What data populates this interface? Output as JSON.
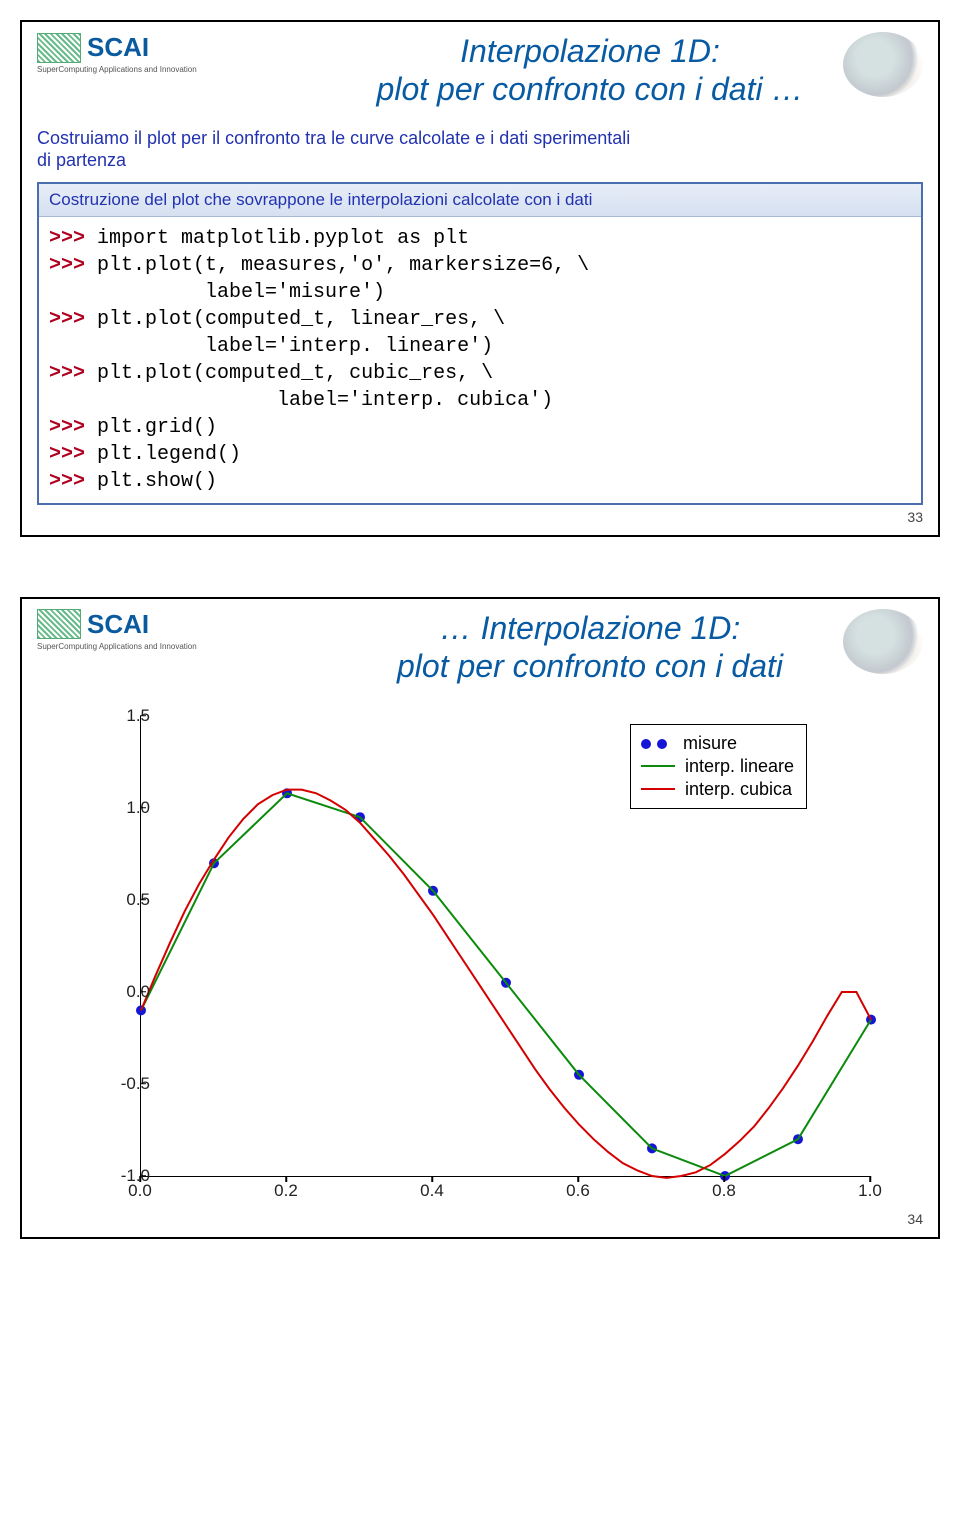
{
  "slide1": {
    "logo": {
      "scai": "SCAI",
      "sub": "SuperComputing Applications and Innovation"
    },
    "title_l1": "Interpolazione 1D:",
    "title_l2": "plot per confronto con i dati …",
    "intro_l1": "Costruiamo il plot per il confronto tra le curve calcolate e i dati sperimentali",
    "intro_l2": "di partenza",
    "code_head": "Costruzione del plot che sovrappone le interpolazioni calcolate con i dati",
    "code": {
      "l1": "import matplotlib.pyplot as plt",
      "l2a": "plt.plot(t, measures,'o', markersize=6, \\",
      "l2b": "         label='misure')",
      "l3a": "plt.plot(computed_t, linear_res, \\",
      "l3b": "         label='interp. lineare')",
      "l4a": "plt.plot(computed_t, cubic_res, \\",
      "l4b": "               label='interp. cubica')",
      "l5": "plt.grid()",
      "l6": "plt.legend()",
      "l7": "plt.show()"
    },
    "pagenum": "33"
  },
  "slide2": {
    "logo": {
      "scai": "SCAI",
      "sub": "SuperComputing Applications and Innovation"
    },
    "title_l1": "… Interpolazione 1D:",
    "title_l2": "plot per confronto con i dati",
    "legend": {
      "misure": "misure",
      "lin": "interp. lineare",
      "cub": "interp. cubica"
    },
    "yticks": [
      "-1.0",
      "-0.5",
      "0.0",
      "0.5",
      "1.0",
      "1.5"
    ],
    "xticks": [
      "0.0",
      "0.2",
      "0.4",
      "0.6",
      "0.8",
      "1.0"
    ],
    "pagenum": "34"
  },
  "chart_data": {
    "type": "line",
    "title": "",
    "xlabel": "",
    "ylabel": "",
    "xlim": [
      0.0,
      1.0
    ],
    "ylim": [
      -1.0,
      1.5
    ],
    "grid": false,
    "legend_position": "upper right",
    "series": [
      {
        "name": "misure",
        "type": "scatter",
        "color": "#1515d6",
        "x": [
          0.0,
          0.1,
          0.2,
          0.3,
          0.4,
          0.5,
          0.6,
          0.7,
          0.8,
          0.9,
          1.0
        ],
        "y": [
          -0.1,
          0.7,
          1.08,
          0.95,
          0.55,
          0.05,
          -0.45,
          -0.85,
          -1.0,
          -0.8,
          -0.15
        ]
      },
      {
        "name": "interp. lineare",
        "type": "line",
        "color": "#0b8a0b",
        "x": [
          0.0,
          0.1,
          0.2,
          0.3,
          0.4,
          0.5,
          0.6,
          0.7,
          0.8,
          0.9,
          1.0
        ],
        "y": [
          -0.1,
          0.7,
          1.08,
          0.95,
          0.55,
          0.05,
          -0.45,
          -0.85,
          -1.0,
          -0.8,
          -0.15
        ]
      },
      {
        "name": "interp. cubica",
        "type": "line",
        "color": "#d40000",
        "x": [
          0.0,
          0.02,
          0.04,
          0.06,
          0.08,
          0.1,
          0.12,
          0.14,
          0.16,
          0.18,
          0.2,
          0.22,
          0.24,
          0.26,
          0.28,
          0.3,
          0.32,
          0.34,
          0.36,
          0.38,
          0.4,
          0.42,
          0.44,
          0.46,
          0.48,
          0.5,
          0.52,
          0.54,
          0.56,
          0.58,
          0.6,
          0.62,
          0.64,
          0.66,
          0.68,
          0.7,
          0.72,
          0.74,
          0.76,
          0.78,
          0.8,
          0.82,
          0.84,
          0.86,
          0.88,
          0.9,
          0.92,
          0.94,
          0.96,
          0.98,
          1.0
        ],
        "y": [
          -0.1,
          0.09,
          0.27,
          0.44,
          0.59,
          0.72,
          0.84,
          0.94,
          1.02,
          1.07,
          1.1,
          1.1,
          1.08,
          1.04,
          0.99,
          0.92,
          0.83,
          0.74,
          0.64,
          0.53,
          0.42,
          0.3,
          0.18,
          0.06,
          -0.06,
          -0.18,
          -0.3,
          -0.42,
          -0.53,
          -0.63,
          -0.72,
          -0.8,
          -0.87,
          -0.93,
          -0.97,
          -1.0,
          -1.01,
          -1.0,
          -0.98,
          -0.94,
          -0.88,
          -0.81,
          -0.73,
          -0.63,
          -0.52,
          -0.4,
          -0.27,
          -0.13,
          0.0,
          0.0,
          -0.15
        ]
      }
    ]
  }
}
